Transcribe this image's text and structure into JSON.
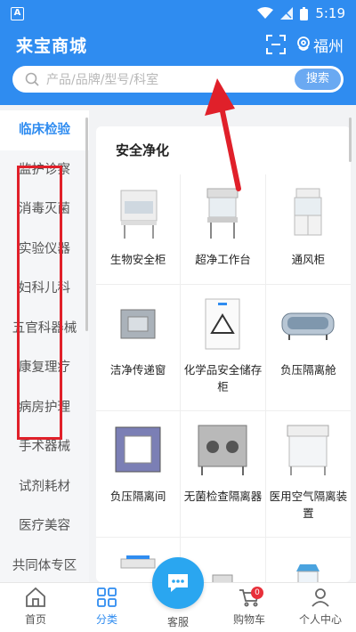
{
  "status_bar": {
    "app_icon_letter": "A",
    "time": "5:19"
  },
  "header": {
    "brand": "来宝商城",
    "city": "福州",
    "search_placeholder": "产品/品牌/型号/科室",
    "search_button": "搜索"
  },
  "sidebar": {
    "active_index": 0,
    "items": [
      "临床检验",
      "监护诊察",
      "消毒灭菌",
      "实验仪器",
      "妇科儿科",
      "五官科器械",
      "康复理疗",
      "病房护理",
      "手术器械",
      "试剂耗材",
      "医疗美容",
      "共同体专区"
    ]
  },
  "content": {
    "section_title": "安全净化",
    "products": [
      {
        "label": "生物安全柜",
        "icon": "biosafety-cabinet"
      },
      {
        "label": "超净工作台",
        "icon": "clean-bench"
      },
      {
        "label": "通风柜",
        "icon": "fume-hood"
      },
      {
        "label": "洁净传递窗",
        "icon": "pass-box"
      },
      {
        "label": "化学品安全储存柜",
        "icon": "chemical-storage-cabinet"
      },
      {
        "label": "负压隔离舱",
        "icon": "isolation-pod"
      },
      {
        "label": "负压隔离间",
        "icon": "isolation-room"
      },
      {
        "label": "无菌检查隔离器",
        "icon": "sterility-isolator"
      },
      {
        "label": "医用空气隔离装置",
        "icon": "air-isolation-unit"
      },
      {
        "label": "",
        "icon": "cabinet"
      },
      {
        "label": "",
        "icon": "trolley"
      },
      {
        "label": "",
        "icon": "booth"
      }
    ]
  },
  "bottom_nav": {
    "items": [
      {
        "label": "首页",
        "icon": "home-icon"
      },
      {
        "label": "分类",
        "icon": "grid-icon"
      },
      {
        "label": "客服",
        "icon": "chat-icon"
      },
      {
        "label": "购物车",
        "icon": "cart-icon",
        "badge": "0"
      },
      {
        "label": "个人中心",
        "icon": "user-icon"
      }
    ],
    "active_index": 1
  },
  "colors": {
    "primary": "#2f8cf0",
    "annotation": "#e0202a"
  }
}
